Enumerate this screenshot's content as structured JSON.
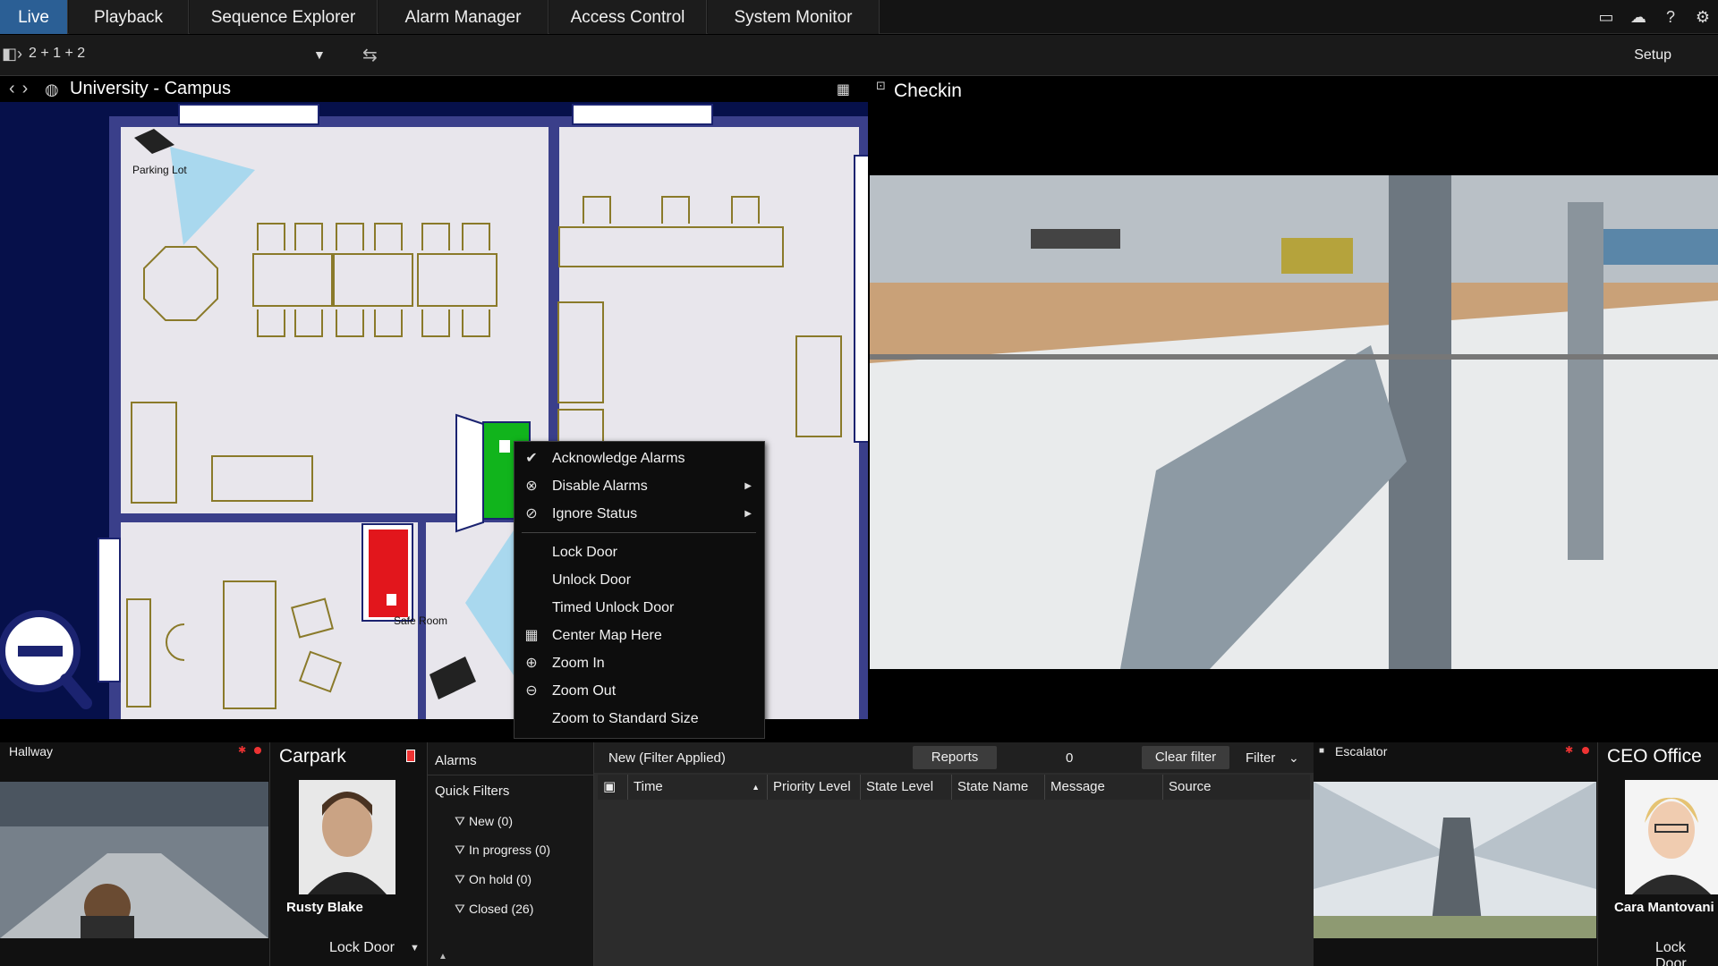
{
  "nav": {
    "tabs": [
      "Live",
      "Playback",
      "Sequence Explorer",
      "Alarm Manager",
      "Access Control",
      "System Monitor"
    ],
    "active": "Live"
  },
  "toolbar": {
    "view_name": "2 + 1 + 2",
    "setup": "Setup"
  },
  "map": {
    "title": "University - Campus",
    "labels": {
      "parking_lot": "Parking Lot",
      "safe_room": "Safe Room"
    }
  },
  "context_menu": {
    "items": [
      {
        "label": "Acknowledge Alarms",
        "icon": "check-icon"
      },
      {
        "label": "Disable Alarms",
        "icon": "disable-alarm-icon",
        "submenu": true
      },
      {
        "label": "Ignore Status",
        "icon": "ban-icon",
        "submenu": true
      },
      {
        "label": "Lock Door"
      },
      {
        "label": "Unlock Door"
      },
      {
        "label": "Timed Unlock Door"
      },
      {
        "label": "Center Map Here",
        "icon": "center-map-icon"
      },
      {
        "label": "Zoom In",
        "icon": "zoom-in-icon"
      },
      {
        "label": "Zoom Out",
        "icon": "zoom-out-icon"
      },
      {
        "label": "Zoom to Standard Size"
      }
    ]
  },
  "camera_main": {
    "title": "Checkin"
  },
  "bottom": {
    "hallway": {
      "title": "Hallway"
    },
    "carpark": {
      "title": "Carpark",
      "person": "Rusty Blake",
      "action": "Lock Door"
    },
    "escalator": {
      "title": "Escalator"
    },
    "ceo": {
      "title": "CEO Office",
      "person": "Cara Mantovani",
      "action": "Lock Door"
    }
  },
  "alarms": {
    "title": "Alarms",
    "quick_filters_label": "Quick Filters",
    "quick_filters": [
      "New (0)",
      "In progress (0)",
      "On hold (0)",
      "Closed (26)"
    ],
    "filter_state": "New (Filter Applied)",
    "reports": "Reports",
    "count": "0",
    "clear_filter": "Clear filter",
    "filter": "Filter",
    "columns": [
      "Time",
      "Priority Level",
      "State Level",
      "State Name",
      "Message",
      "Source"
    ]
  },
  "colors": {
    "active_tab": "#2b5f95",
    "map_bg": "#06104a",
    "room_floor": "#e8e6ec",
    "door_green": "#11b41c",
    "door_red": "#e2161c"
  }
}
